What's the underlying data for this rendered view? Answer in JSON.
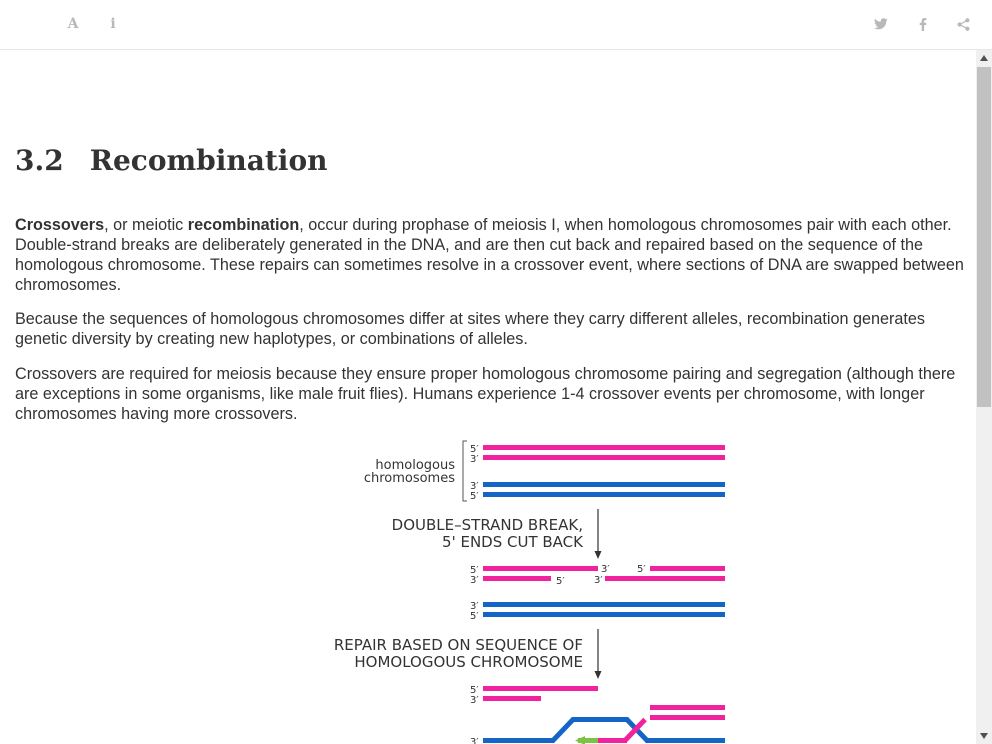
{
  "toolbar": {
    "font_glyph": "A",
    "info_glyph": "i",
    "icons": [
      "font-settings-icon",
      "info-icon",
      "twitter-icon",
      "facebook-icon",
      "share-icon"
    ]
  },
  "section": {
    "number": "3.2",
    "title": "Recombination"
  },
  "paragraphs": {
    "p1": {
      "term1": "Crossovers",
      "text1": ", or meiotic ",
      "term2": "recombination",
      "text2": ", occur during prophase of meiosis I, when homologous chromosomes pair with each other. Double-strand breaks are deliberately generated in the DNA, and are then cut back and repaired based on the sequence of the homologous chromosome. These repairs can sometimes resolve in a crossover event, where sections of DNA are swapped between chromosomes."
    },
    "p2": "Because the sequences of homologous chromosomes differ at sites where they carry different alleles, recombination generates genetic diversity by creating new haplotypes, or combinations of alleles.",
    "p3": "Crossovers are required for meiosis because they ensure proper homologous chromosome pairing and segregation (although there are exceptions in some organisms, like male fruit flies). Humans experience 1-4 crossover events per chromosome, with longer chromosomes having more crossovers."
  },
  "diagram": {
    "label_homologous_1": "homologous",
    "label_homologous_2": "chromosomes",
    "step1_line1": "DOUBLE–STRAND BREAK,",
    "step1_line2": "5' ENDS CUT BACK",
    "step2_line1": "REPAIR BASED ON SEQUENCE OF",
    "step2_line2": "HOMOLOGOUS CHROMOSOME",
    "end_5": "5′",
    "end_3": "3′",
    "colors": {
      "pink": "#f0229e",
      "blue": "#1565c7",
      "green": "#7dc242"
    }
  },
  "colors": {
    "toolbar_icon": "#b8b8b8",
    "text": "#333333"
  }
}
